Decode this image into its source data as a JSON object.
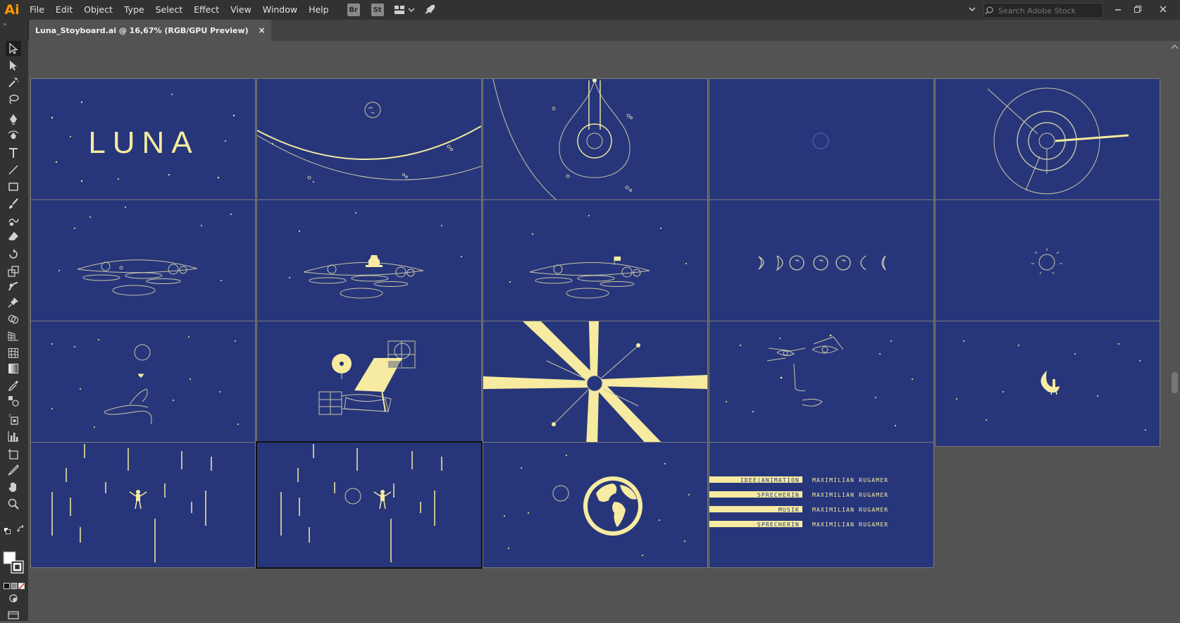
{
  "app": {
    "logo": "Ai",
    "brand_color": "#ff9a00"
  },
  "menu": [
    "File",
    "Edit",
    "Object",
    "Type",
    "Select",
    "Effect",
    "View",
    "Window",
    "Help"
  ],
  "toolbar_icons": {
    "bridge": "Br",
    "stock": "St"
  },
  "search": {
    "placeholder": "Search Adobe Stock"
  },
  "document_tab": {
    "title": "Luna_Stoyboard.ai @ 16,67% (RGB/GPU Preview)",
    "close": "×"
  },
  "colors": {
    "board_bg": "#27367a",
    "ink": "#f6eba0",
    "line": "#c9c6a8"
  },
  "artboards": {
    "title_text": "LUNA",
    "credits": [
      {
        "role": "IDEE|ANIMATION",
        "name": "MAXIMILIAN RUGAMER"
      },
      {
        "role": "SPRECHERIN",
        "name": "MAXIMILIAN RUGAMER"
      },
      {
        "role": "MUSIK",
        "name": "MAXIMILIAN RUGAMER"
      },
      {
        "role": "SPRECHERIN",
        "name": "MAXIMILIAN RUGAMER"
      }
    ]
  }
}
